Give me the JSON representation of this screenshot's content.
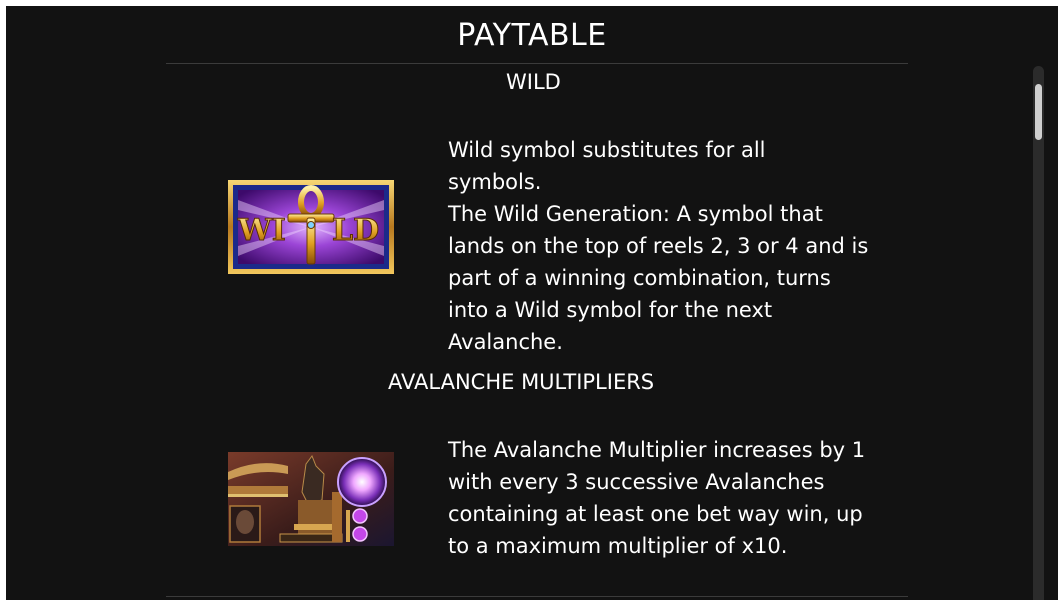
{
  "paytable": {
    "title": "PAYTABLE"
  },
  "wild": {
    "heading": "WILD",
    "description": "Wild symbol substitutes for all\nsymbols.\nThe Wild Generation: A symbol that\nlands on the top of reels 2, 3 or 4 and is\npart of a winning combination, turns\ninto a Wild symbol for the next\nAvalanche.",
    "symbol_text_left": "WI",
    "symbol_text_right": "LD"
  },
  "avalanche": {
    "heading": "AVALANCHE MULTIPLIERS",
    "description": "The Avalanche Multiplier increases by 1\nwith every 3 successive Avalanches\ncontaining at least one bet way win, up\nto a maximum multiplier of x10."
  },
  "colors": {
    "background": "#121212",
    "text": "#ffffff",
    "gold": "#d9a63a",
    "purple": "#8a3fd0"
  }
}
